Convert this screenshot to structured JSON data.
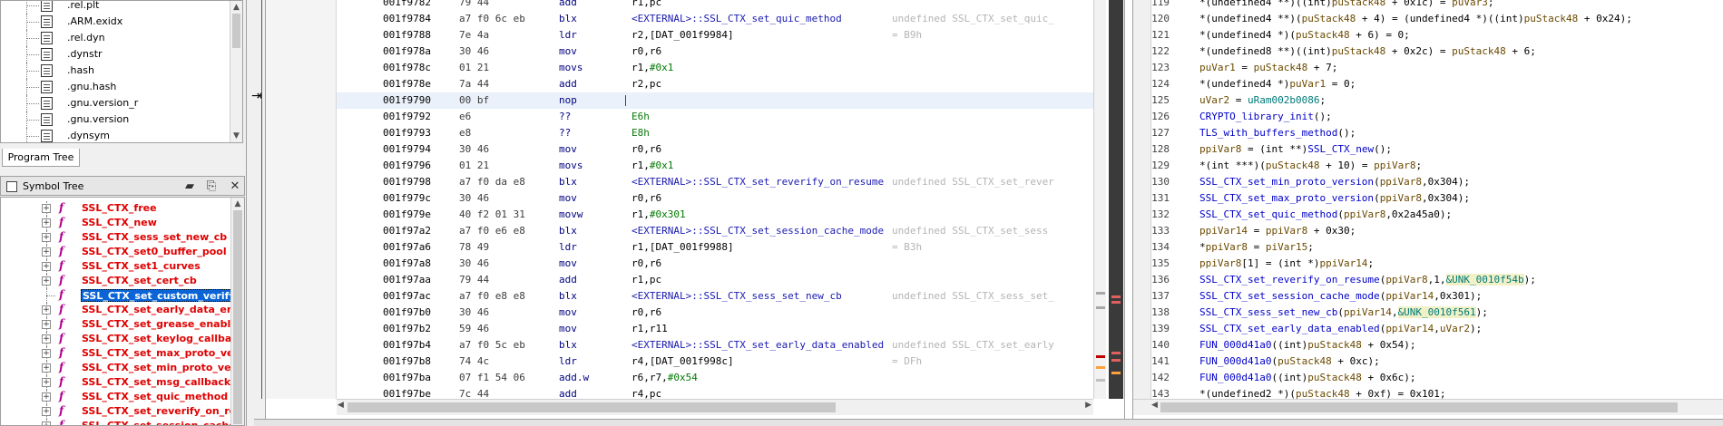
{
  "program_tree": {
    "items": [
      ".rel.plt",
      ".ARM.exidx",
      ".rel.dyn",
      ".dynstr",
      ".hash",
      ".gnu.hash",
      ".gnu.version_r",
      ".gnu.version",
      ".dynsym"
    ],
    "tab_label": "Program Tree"
  },
  "symbol_tree": {
    "title": "Symbol Tree",
    "items": [
      {
        "name": "SSL_CTX_free",
        "selected": false
      },
      {
        "name": "SSL_CTX_new",
        "selected": false
      },
      {
        "name": "SSL_CTX_sess_set_new_cb",
        "selected": false
      },
      {
        "name": "SSL_CTX_set0_buffer_pool",
        "selected": false
      },
      {
        "name": "SSL_CTX_set1_curves",
        "selected": false
      },
      {
        "name": "SSL_CTX_set_cert_cb",
        "selected": false
      },
      {
        "name": "SSL_CTX_set_custom_verify",
        "selected": true
      },
      {
        "name": "SSL_CTX_set_early_data_ena",
        "selected": false
      },
      {
        "name": "SSL_CTX_set_grease_enable",
        "selected": false
      },
      {
        "name": "SSL_CTX_set_keylog_callbac",
        "selected": false
      },
      {
        "name": "SSL_CTX_set_max_proto_ver",
        "selected": false
      },
      {
        "name": "SSL_CTX_set_min_proto_ver",
        "selected": false
      },
      {
        "name": "SSL_CTX_set_msg_callback",
        "selected": false
      },
      {
        "name": "SSL_CTX_set_quic_method",
        "selected": false
      },
      {
        "name": "SSL_CTX_set_reverify_on_re",
        "selected": false
      },
      {
        "name": "SSL_CTX_set_session_cache",
        "selected": false
      }
    ]
  },
  "listing": {
    "rows": [
      {
        "addr": "001f9782",
        "bytes": "79 44",
        "mnemonic": "add",
        "operands": "r1,pc",
        "comment": ""
      },
      {
        "addr": "001f9784",
        "bytes": "a7 f0 6c eb",
        "mnemonic": "blx",
        "operands": "<EXTERNAL>::SSL_CTX_set_quic_method",
        "comment": "undefined SSL_CTX_set_quic_"
      },
      {
        "addr": "001f9788",
        "bytes": "7e 4a",
        "mnemonic": "ldr",
        "operands": "r2,[DAT_001f9984]",
        "comment": "= B9h"
      },
      {
        "addr": "001f978a",
        "bytes": "30 46",
        "mnemonic": "mov",
        "operands": "r0,r6",
        "comment": ""
      },
      {
        "addr": "001f978c",
        "bytes": "01 21",
        "mnemonic": "movs",
        "operands": "r1,#0x1",
        "comment": ""
      },
      {
        "addr": "001f978e",
        "bytes": "7a 44",
        "mnemonic": "add",
        "operands": "r2,pc",
        "comment": ""
      },
      {
        "addr": "001f9790",
        "bytes": "00 bf",
        "mnemonic": "nop",
        "operands": "",
        "comment": ""
      },
      {
        "addr": "001f9792",
        "bytes": "e6",
        "mnemonic": "??",
        "operands": "E6h",
        "comment": ""
      },
      {
        "addr": "001f9793",
        "bytes": "e8",
        "mnemonic": "??",
        "operands": "E8h",
        "comment": ""
      },
      {
        "addr": "001f9794",
        "bytes": "30 46",
        "mnemonic": "mov",
        "operands": "r0,r6",
        "comment": ""
      },
      {
        "addr": "001f9796",
        "bytes": "01 21",
        "mnemonic": "movs",
        "operands": "r1,#0x1",
        "comment": ""
      },
      {
        "addr": "001f9798",
        "bytes": "a7 f0 da e8",
        "mnemonic": "blx",
        "operands": "<EXTERNAL>::SSL_CTX_set_reverify_on_resume",
        "comment": "undefined SSL_CTX_set_rever"
      },
      {
        "addr": "001f979c",
        "bytes": "30 46",
        "mnemonic": "mov",
        "operands": "r0,r6",
        "comment": ""
      },
      {
        "addr": "001f979e",
        "bytes": "40 f2 01 31",
        "mnemonic": "movw",
        "operands": "r1,#0x301",
        "comment": ""
      },
      {
        "addr": "001f97a2",
        "bytes": "a7 f0 e6 e8",
        "mnemonic": "blx",
        "operands": "<EXTERNAL>::SSL_CTX_set_session_cache_mode",
        "comment": "undefined SSL_CTX_set_sess"
      },
      {
        "addr": "001f97a6",
        "bytes": "78 49",
        "mnemonic": "ldr",
        "operands": "r1,[DAT_001f9988]",
        "comment": "= B3h"
      },
      {
        "addr": "001f97a8",
        "bytes": "30 46",
        "mnemonic": "mov",
        "operands": "r0,r6",
        "comment": ""
      },
      {
        "addr": "001f97aa",
        "bytes": "79 44",
        "mnemonic": "add",
        "operands": "r1,pc",
        "comment": ""
      },
      {
        "addr": "001f97ac",
        "bytes": "a7 f0 e8 e8",
        "mnemonic": "blx",
        "operands": "<EXTERNAL>::SSL_CTX_sess_set_new_cb",
        "comment": "undefined SSL_CTX_sess_set_"
      },
      {
        "addr": "001f97b0",
        "bytes": "30 46",
        "mnemonic": "mov",
        "operands": "r0,r6",
        "comment": ""
      },
      {
        "addr": "001f97b2",
        "bytes": "59 46",
        "mnemonic": "mov",
        "operands": "r1,r11",
        "comment": ""
      },
      {
        "addr": "001f97b4",
        "bytes": "a7 f0 5c eb",
        "mnemonic": "blx",
        "operands": "<EXTERNAL>::SSL_CTX_set_early_data_enabled",
        "comment": "undefined SSL_CTX_set_early"
      },
      {
        "addr": "001f97b8",
        "bytes": "74 4c",
        "mnemonic": "ldr",
        "operands": "r4,[DAT_001f998c]",
        "comment": "= DFh"
      },
      {
        "addr": "001f97ba",
        "bytes": "07 f1 54 06",
        "mnemonic": "add.w",
        "operands": "r6,r7,#0x54",
        "comment": ""
      },
      {
        "addr": "001f97be",
        "bytes": "7c 44",
        "mnemonic": "add",
        "operands": "r4,pc",
        "comment": ""
      }
    ]
  },
  "decompiler": {
    "rows": [
      {
        "ln": "119",
        "code": "*(undefined4 **)((int)puStack48 + 0x1c) = puVar3;"
      },
      {
        "ln": "120",
        "code": "*(undefined4 **)(puStack48 + 4) = (undefined4 *)((int)puStack48 + 0x24);"
      },
      {
        "ln": "121",
        "code": "*(undefined4 *)(puStack48 + 6) = 0;"
      },
      {
        "ln": "122",
        "code": "*(undefined8 **)((int)puStack48 + 0x2c) = puStack48 + 6;"
      },
      {
        "ln": "123",
        "code": "puVar1 = puStack48 + 7;"
      },
      {
        "ln": "124",
        "code": "*(undefined4 *)puVar1 = 0;"
      },
      {
        "ln": "125",
        "code": "uVar2 = uRam002b0086;"
      },
      {
        "ln": "126",
        "code": "CRYPTO_library_init();"
      },
      {
        "ln": "127",
        "code": "TLS_with_buffers_method();"
      },
      {
        "ln": "128",
        "code": "ppiVar8 = (int **)SSL_CTX_new();"
      },
      {
        "ln": "129",
        "code": "*(int ***)(puStack48 + 10) = ppiVar8;"
      },
      {
        "ln": "130",
        "code": "SSL_CTX_set_min_proto_version(ppiVar8,0x304);"
      },
      {
        "ln": "131",
        "code": "SSL_CTX_set_max_proto_version(ppiVar8,0x304);"
      },
      {
        "ln": "132",
        "code": "SSL_CTX_set_quic_method(ppiVar8,0x2a45a0);"
      },
      {
        "ln": "133",
        "code": "ppiVar14 = ppiVar8 + 0x30;"
      },
      {
        "ln": "134",
        "code": "*ppiVar8 = piVar15;"
      },
      {
        "ln": "135",
        "code": "ppiVar8[1] = (int *)ppiVar14;"
      },
      {
        "ln": "136",
        "code": "SSL_CTX_set_reverify_on_resume(ppiVar8,1,&UNK_0010f54b);"
      },
      {
        "ln": "137",
        "code": "SSL_CTX_set_session_cache_mode(ppiVar14,0x301);"
      },
      {
        "ln": "138",
        "code": "SSL_CTX_sess_set_new_cb(ppiVar14,&UNK_0010f561);"
      },
      {
        "ln": "139",
        "code": "SSL_CTX_set_early_data_enabled(ppiVar14,uVar2);"
      },
      {
        "ln": "140",
        "code": "FUN_000d41a0((int)puStack48 + 0x54);"
      },
      {
        "ln": "141",
        "code": "FUN_000d41a0(puStack48 + 0xc);"
      },
      {
        "ln": "142",
        "code": "FUN_000d41a0((int)puStack48 + 0x6c);"
      },
      {
        "ln": "143",
        "code": "*(undefined2 *)(puStack48 + 0xf) = 0x101;"
      }
    ]
  },
  "colors": {
    "selection": "#0a64d6",
    "symbol_name": "#e00000",
    "function_icon": "#b0008a",
    "mnemonic": "#000080"
  }
}
